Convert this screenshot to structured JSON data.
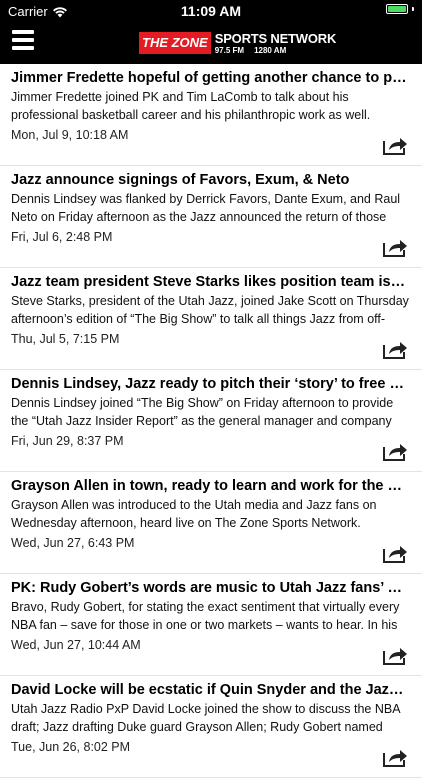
{
  "status_bar": {
    "carrier": "Carrier",
    "time": "11:09 AM",
    "battery_level": 1.0,
    "battery_color": "#4cd964"
  },
  "nav": {
    "logo_zone": "THE ZONE",
    "logo_title": "SPORTS NETWORK",
    "logo_freq_fm": "97.5 FM",
    "logo_freq_am": "1280 AM",
    "menu_icon": "hamburger-menu-icon",
    "brand_color": "#e31b23"
  },
  "articles": [
    {
      "title": "Jimmer Fredette hopeful of getting another chance to play in the NBA",
      "summary": "Jimmer Fredette joined PK and Tim LaComb to talk about his professional basketball career and his philanthropic work as well.",
      "date": "Mon, Jul 9, 10:18 AM"
    },
    {
      "title": "Jazz announce signings of Favors, Exum, & Neto",
      "summary": "Dennis Lindsey was flanked by Derrick Favors, Dante Exum, and Raul Neto on Friday afternoon as the Jazz announced the return of those",
      "date": "Fri, Jul 6, 2:48 PM"
    },
    {
      "title": "Jazz team president Steve Starks likes position team is in, looking forward",
      "summary": "Steve Starks, president of the Utah Jazz, joined Jake Scott on Thursday afternoon’s edition of “The Big Show” to talk all things Jazz from off-",
      "date": "Thu, Jul 5, 7:15 PM"
    },
    {
      "title": "Dennis Lindsey, Jazz ready to pitch their ‘story’ to free agents",
      "summary": "Dennis Lindsey joined “The Big Show” on Friday afternoon to provide the “Utah Jazz Insider Report” as the general manager and company was",
      "date": "Fri, Jun 29, 8:37 PM"
    },
    {
      "title": "Grayson Allen in town, ready to learn and work for the Utah Jazz",
      "summary": "Grayson Allen was introduced to the Utah media and Jazz fans on Wednesday afternoon, heard live on The Zone Sports Network.",
      "date": "Wed, Jun 27, 6:43 PM"
    },
    {
      "title": "PK: Rudy Gobert’s words are music to Utah Jazz fans’ ears",
      "summary": "Bravo, Rudy Gobert, for stating the exact sentiment that virtually every NBA fan – save for those in one or two markets – wants to hear. In his",
      "date": "Wed, Jun 27, 10:44 AM"
    },
    {
      "title": "David Locke will be ecstatic if Quin Snyder and the Jazz are together",
      "summary": "Utah Jazz Radio PxP David Locke joined the show to discuss the NBA draft; Jazz drafting Duke guard Grayson Allen; Rudy Gobert named",
      "date": "Tue, Jun 26, 8:02 PM"
    }
  ],
  "share_icon": "share-icon"
}
